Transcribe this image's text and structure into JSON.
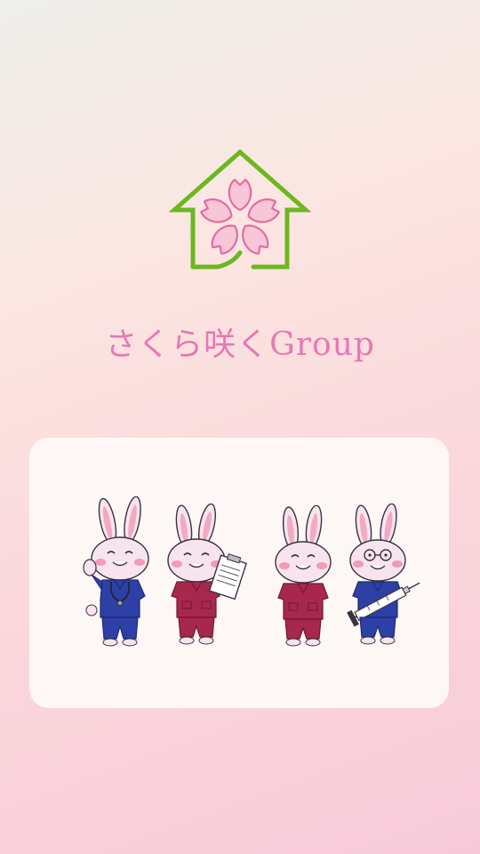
{
  "brand": {
    "name": "さくら咲くGroup",
    "logo_icon": "house-sakura-icon",
    "colors": {
      "house": "#6cb81f",
      "petal_fill": "#f7c6d7",
      "petal_stroke": "#e66aa6",
      "name_text": "#e977b4"
    }
  },
  "illustration": {
    "mascots": [
      {
        "icon": "rabbit-doctor-icon",
        "scrubs_color": "#2e3fa6"
      },
      {
        "icon": "rabbit-nurse-clipboard-icon",
        "scrubs_color": "#a8284d"
      },
      {
        "icon": "rabbit-nurse-icon",
        "scrubs_color": "#a8284d"
      },
      {
        "icon": "rabbit-syringe-icon",
        "scrubs_color": "#2e3fa6"
      }
    ]
  }
}
